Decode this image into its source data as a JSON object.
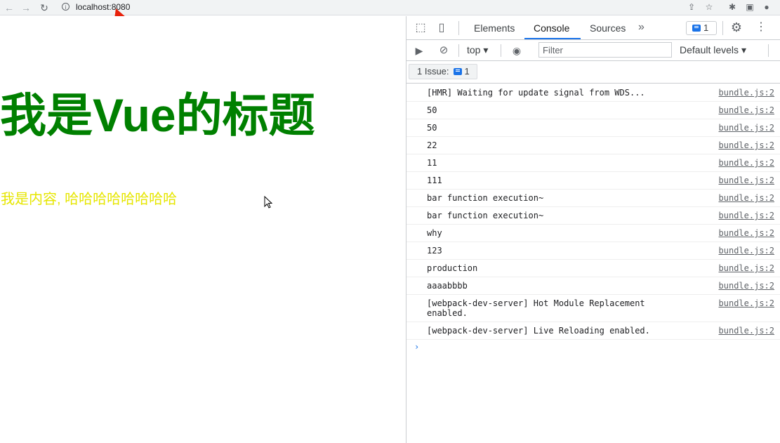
{
  "browser": {
    "url": "localhost:8080",
    "icons": [
      "back-arrow-icon",
      "forward-arrow-icon",
      "reload-icon",
      "info-icon",
      "share-icon",
      "star-icon",
      "extension-puzzle-icon",
      "side-panel-icon",
      "profile-icon"
    ]
  },
  "page": {
    "title": "我是Vue的标题",
    "content": "我是内容, 哈哈哈哈哈哈哈哈",
    "colors": {
      "title": "#008000",
      "content": "#e6e600"
    }
  },
  "devtools": {
    "tabs": [
      {
        "label": "Elements"
      },
      {
        "label": "Console"
      },
      {
        "label": "Sources"
      }
    ],
    "active_tab": "Console",
    "issues_count": "1",
    "toolbar": {
      "context": "top",
      "filter_placeholder": "Filter",
      "levels": "Default levels"
    },
    "issues_link": {
      "label": "1 Issue:",
      "count": "1"
    },
    "console_messages": [
      {
        "text": "[HMR] Waiting for update signal from WDS...",
        "source": "bundle.js:2"
      },
      {
        "text": "50",
        "source": "bundle.js:2"
      },
      {
        "text": "50",
        "source": "bundle.js:2"
      },
      {
        "text": "22",
        "source": "bundle.js:2"
      },
      {
        "text": "11",
        "source": "bundle.js:2"
      },
      {
        "text": "111",
        "source": "bundle.js:2"
      },
      {
        "text": "bar function execution~",
        "source": "bundle.js:2"
      },
      {
        "text": "bar function execution~",
        "source": "bundle.js:2"
      },
      {
        "text": "why",
        "source": "bundle.js:2"
      },
      {
        "text": "123",
        "source": "bundle.js:2"
      },
      {
        "text": "production",
        "source": "bundle.js:2"
      },
      {
        "text": "aaaabbbb",
        "source": "bundle.js:2"
      },
      {
        "text": "[webpack-dev-server] Hot Module Replacement enabled.",
        "source": "bundle.js:2"
      },
      {
        "text": "[webpack-dev-server] Live Reloading enabled.",
        "source": "bundle.js:2"
      }
    ],
    "prompt_symbol": "›"
  }
}
